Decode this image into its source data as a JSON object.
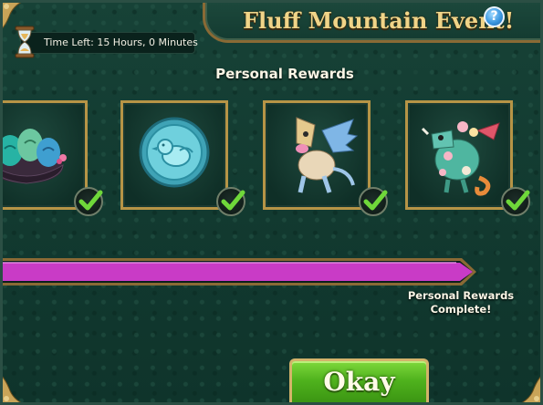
{
  "header": {
    "title": "Fluff Mountain Event!",
    "help_icon": "question-icon",
    "help_label": "?"
  },
  "timer": {
    "icon": "hourglass-icon",
    "text": "Time Left: 15 Hours, 0 Minutes"
  },
  "rewards": {
    "section_title": "Personal Rewards",
    "items": [
      {
        "name": "nest-reward",
        "claimed": true
      },
      {
        "name": "bird-coin-reward",
        "claimed": true
      },
      {
        "name": "winged-dragon-reward",
        "claimed": true
      },
      {
        "name": "flower-chameleon-dragon-reward",
        "claimed": true
      }
    ]
  },
  "progress": {
    "fraction": 1.0,
    "status_text": "Personal Rewards\nComplete!"
  },
  "actions": {
    "okay_label": "Okay"
  },
  "colors": {
    "progress_fill": "#c93bc6",
    "button_green": "#4fb21d",
    "gold_border": "#b69446",
    "title_gold": "#f0d488"
  }
}
